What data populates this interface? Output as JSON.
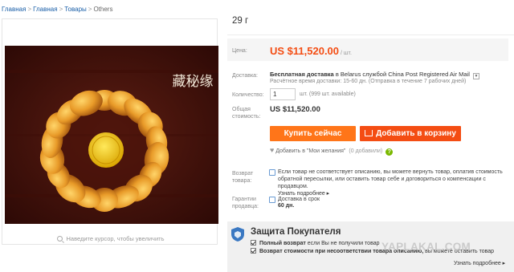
{
  "breadcrumb": {
    "items": [
      "Главная",
      "Главная",
      "Товары"
    ],
    "current": "Others"
  },
  "product": {
    "title": "29 г"
  },
  "gallery": {
    "stamp_text": "藏秘缘",
    "zoom_hint": "Наведите курсор, чтобы увеличить"
  },
  "price": {
    "label": "Цена:",
    "value": "US $11,520.00",
    "unit": "/ шт."
  },
  "delivery": {
    "label": "Доставка:",
    "free_shipping": "Бесплатная доставка",
    "destination": "в Belarus службой China Post Registered Air Mail",
    "estimate": "Расчётное время доставки: 15-60 дн. (Отправка в течение 7 рабочих дней)"
  },
  "quantity": {
    "label": "Количество:",
    "value": "1",
    "available": "шт. (999 шт. available)"
  },
  "total": {
    "label_line1": "Общая",
    "label_line2": "стоимость:",
    "value": "US $11,520.00"
  },
  "actions": {
    "buy_now": "Купить сейчас",
    "add_to_cart": "Добавить в корзину"
  },
  "wishlist": {
    "label": "Добавить в \"Мои желания\"",
    "count": "(0 добавили)",
    "help": "?"
  },
  "returns": {
    "label_line1": "Возврат",
    "label_line2": "товара:",
    "text": "Если товар не соответствует описанию, вы можете вернуть товар, оплатив стоимость обратной пересылки, или оставить товар себе и договориться о компенсации с продавцом.",
    "more": "Узнать подробнее ▸"
  },
  "guarantee": {
    "label_line1": "Гарантии",
    "label_line2": "продавца:",
    "text": "Доставка в срок",
    "days": "60 дн."
  },
  "protection": {
    "title": "Защита Покупателя",
    "line1_bold": "Полный возврат",
    "line1_rest": "если Вы не получили товар",
    "line2_bold": "Возврат стоимости при несоответствии товара описанию,",
    "line2_rest": "вы можете оставить товар",
    "more": "Узнать подробнее ▸"
  },
  "watermark": "YAPLAKAL.COM",
  "colors": {
    "price_orange": "#f44d13",
    "buy_button": "#ff7519",
    "cart_button": "#f44d13",
    "link_blue": "#1a5fa8",
    "help_green": "#7ab800"
  }
}
